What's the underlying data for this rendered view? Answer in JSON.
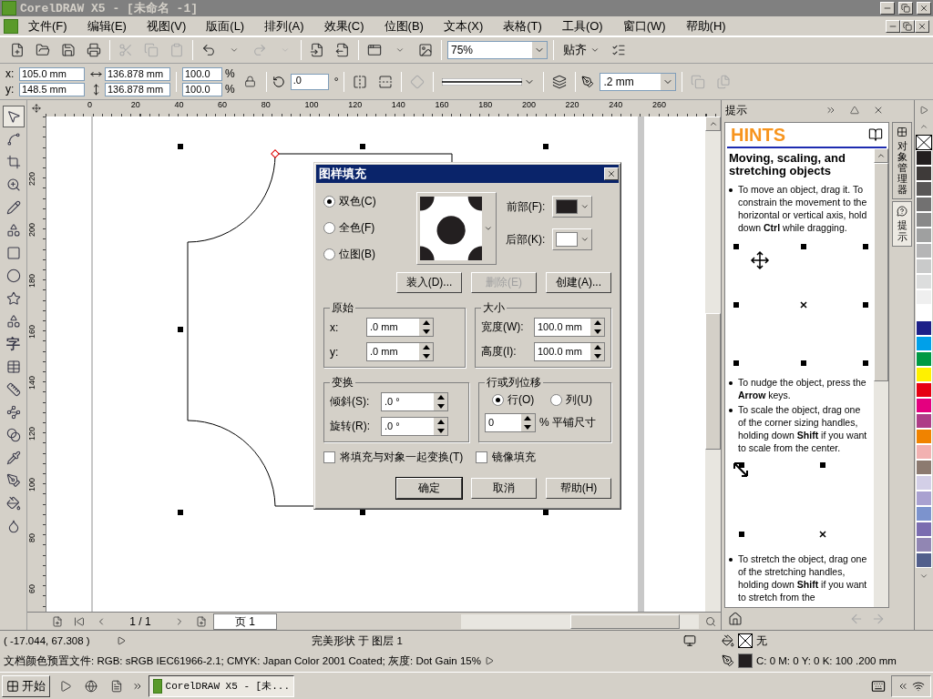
{
  "window": {
    "title": "CorelDRAW X5 - [未命名 -1]"
  },
  "menu": [
    "文件(F)",
    "编辑(E)",
    "视图(V)",
    "版面(L)",
    "排列(A)",
    "效果(C)",
    "位图(B)",
    "文本(X)",
    "表格(T)",
    "工具(O)",
    "窗口(W)",
    "帮助(H)"
  ],
  "toolbar": {
    "zoom": "75%",
    "snap": "贴齐"
  },
  "property_bar": {
    "x_label": "x:",
    "x": "105.0 mm",
    "y_label": "y:",
    "y": "148.5 mm",
    "width": "136.878 mm",
    "height": "136.878 mm",
    "scale": [
      {
        "value": "100.0",
        "unit": "%"
      },
      {
        "value": "100.0",
        "unit": "%"
      }
    ],
    "rotation": {
      "value": ".0",
      "unit": "°"
    },
    "outline_width": ".2 mm"
  },
  "toolbox": [
    {
      "kind": "pick",
      "selected": true
    },
    {
      "kind": "shape",
      "selected": false
    },
    {
      "kind": "crop",
      "selected": false
    },
    {
      "kind": "zoom",
      "selected": false
    },
    {
      "kind": "freehand",
      "selected": false
    },
    {
      "kind": "smart",
      "selected": false
    },
    {
      "kind": "rectangle",
      "selected": false
    },
    {
      "kind": "ellipse",
      "selected": false
    },
    {
      "kind": "polygon",
      "selected": false
    },
    {
      "kind": "basicshapes",
      "selected": false
    },
    {
      "kind": "text",
      "label": "字",
      "selected": false
    },
    {
      "kind": "table",
      "selected": false
    },
    {
      "kind": "dimension",
      "selected": false
    },
    {
      "kind": "connector",
      "selected": false
    },
    {
      "kind": "blend",
      "selected": false
    },
    {
      "kind": "eyedropper",
      "selected": false
    },
    {
      "kind": "outline",
      "selected": false
    },
    {
      "kind": "fill",
      "selected": false
    },
    {
      "kind": "interactivefill",
      "selected": false
    }
  ],
  "rulers": {
    "horizontal": [
      "0",
      "20",
      "40",
      "60",
      "80",
      "100",
      "120",
      "140",
      "160",
      "180",
      "200",
      "220",
      "240",
      "260"
    ],
    "vertical": [
      "220",
      "200",
      "180",
      "160",
      "140",
      "120",
      "100",
      "80",
      "60"
    ]
  },
  "dialog": {
    "title": "图样填充",
    "fill_types": [
      {
        "label": "双色(C)",
        "selected": true
      },
      {
        "label": "全色(F)",
        "selected": false
      },
      {
        "label": "位图(B)",
        "selected": false
      }
    ],
    "foreground": {
      "label": "前部(F):",
      "color": "#231f20"
    },
    "background": {
      "label": "后部(K):",
      "color": "#ffffff"
    },
    "pattern_buttons": [
      {
        "label": "装入(D)...",
        "disabled": false
      },
      {
        "label": "删除(E)",
        "disabled": true
      },
      {
        "label": "创建(A)...",
        "disabled": false
      }
    ],
    "origin": {
      "title": "原始",
      "fields": [
        {
          "label": "x:",
          "value": ".0 mm"
        },
        {
          "label": "y:",
          "value": ".0 mm"
        }
      ]
    },
    "size": {
      "title": "大小",
      "fields": [
        {
          "label": "宽度(W):",
          "value": "100.0 mm"
        },
        {
          "label": "高度(I):",
          "value": "100.0 mm"
        }
      ]
    },
    "transform": {
      "title": "变换",
      "fields": [
        {
          "label": "倾斜(S):",
          "value": ".0 °"
        },
        {
          "label": "旋转(R):",
          "value": ".0 °"
        }
      ]
    },
    "offset": {
      "title": "行或列位移",
      "options": [
        {
          "label": "行(O)",
          "selected": true
        },
        {
          "label": "列(U)",
          "selected": false
        }
      ],
      "value": "0",
      "suffix": "% 平铺尺寸"
    },
    "checkboxes": [
      {
        "label": "将填充与对象一起变换(T)",
        "checked": false
      },
      {
        "label": "镜像填充",
        "checked": false
      }
    ],
    "actions": [
      {
        "label": "确定",
        "default": true
      },
      {
        "label": "取消",
        "default": false
      },
      {
        "label": "帮助(H)",
        "default": false
      }
    ]
  },
  "docker": {
    "title": "提示",
    "heading": "HINTS",
    "topic": "Moving, scaling, and stretching objects",
    "blocks": [
      {
        "kind": "bullet",
        "text": "To move an object, drag it. To constrain the movement to the horizontal or vertical axis, hold down **Ctrl** while dragging."
      },
      {
        "kind": "movefigure"
      },
      {
        "kind": "bullet",
        "text": "To nudge the object, press the **Arrow** keys."
      },
      {
        "kind": "bullet",
        "text": "To scale the object, drag one of the corner sizing handles, holding down **Shift** if you want to scale from the center."
      },
      {
        "kind": "scalefigure"
      },
      {
        "kind": "bullet",
        "text": "To stretch the object, drag one of the stretching handles, holding down **Shift** if you want to stretch from the"
      }
    ]
  },
  "docker_tabs": [
    {
      "label": "对象管理器",
      "selected": false
    },
    {
      "label": "提示",
      "selected": true
    }
  ],
  "palette": [
    {
      "kind": "none"
    },
    {
      "color": "#231f20"
    },
    {
      "color": "#3e3a39"
    },
    {
      "color": "#595757"
    },
    {
      "color": "#727171"
    },
    {
      "color": "#898989"
    },
    {
      "color": "#9fa0a0"
    },
    {
      "color": "#b5b5b6"
    },
    {
      "color": "#c9caca"
    },
    {
      "color": "#dcdddd"
    },
    {
      "color": "#efefef"
    },
    {
      "color": "#ffffff"
    },
    {
      "color": "#1d2088"
    },
    {
      "color": "#00a0e9"
    },
    {
      "color": "#009944"
    },
    {
      "color": "#fff100"
    },
    {
      "color": "#e60012"
    },
    {
      "color": "#e4007f"
    },
    {
      "color": "#ae3d87"
    },
    {
      "color": "#f08300"
    },
    {
      "color": "#f2b1b1"
    },
    {
      "color": "#8c7a70"
    },
    {
      "color": "#d3cfe7"
    },
    {
      "color": "#a9a1d0"
    },
    {
      "color": "#7c93cd"
    },
    {
      "color": "#7b6db0"
    },
    {
      "color": "#9186b3"
    },
    {
      "color": "#525f8c"
    }
  ],
  "page_nav": {
    "count": "1 / 1",
    "tabs": [
      {
        "label": "页 1",
        "selected": true
      }
    ]
  },
  "status": {
    "coordinates": "( -17.044, 67.308 )",
    "object": "完美形状 于 图层 1",
    "profile": "文档颜色预置文件: RGB: sRGB IEC61966-2.1; CMYK: Japan Color 2001 Coated; 灰度: Dot Gain 15%",
    "fill": "无",
    "outline": "C: 0 M: 0 Y: 0 K: 100  .200 mm"
  },
  "taskbar": {
    "start": "开始",
    "tasks": [
      {
        "label": "CorelDRAW X5 - [未...",
        "selected": true
      }
    ]
  }
}
